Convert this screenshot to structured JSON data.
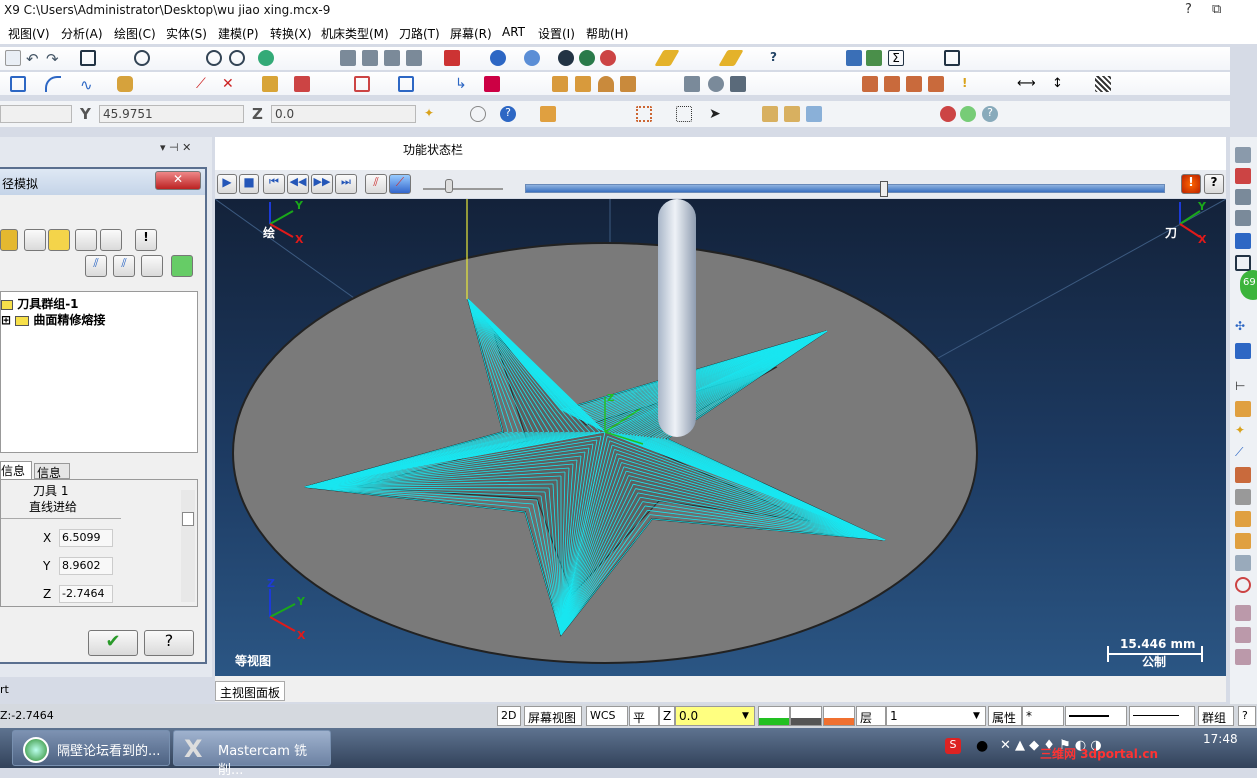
{
  "titlebar": {
    "title": "X9  C:\\Users\\Administrator\\Desktop\\wu jiao xing.mcx-9",
    "win_help": "?",
    "win_restore": "⧉"
  },
  "menu": [
    "视图(V)",
    "分析(A)",
    "绘图(C)",
    "实体(S)",
    "建模(P)",
    "转换(X)",
    "机床类型(M)",
    "刀路(T)",
    "屏幕(R)",
    "ART",
    "设置(I)",
    "帮助(H)"
  ],
  "coords": {
    "y_label": "Y",
    "y_value": "45.9751",
    "z_label": "Z",
    "z_value": "0.0"
  },
  "status_panel_label": "功能状态栏",
  "left": {
    "dialog_title": "径模拟",
    "tree_items": [
      "刀具群组-1",
      "曲面精修熔接"
    ],
    "tabs": [
      "信息",
      "信息"
    ],
    "info_tool": "刀具 1",
    "info_move": "直线进给",
    "x_label": "X",
    "x_value": "6.5099",
    "y_label": "Y",
    "y_value": "8.9602",
    "z_label": "Z",
    "z_value": "-2.7464",
    "footer": "rt"
  },
  "viewport": {
    "view_name": "等视图",
    "scale": "15.446 mm",
    "unit": "公制",
    "axis_tl": "绘",
    "axis_tr": "刀",
    "axis_x": "X",
    "axis_y": "Y",
    "axis_z": "Z",
    "badge": "69"
  },
  "bottom_tab": "主视图面板",
  "statusbar": {
    "left": "Z:-2.7464",
    "mode2d": "2D",
    "screen_view": "屏幕视图",
    "wcs": "WCS",
    "plane": "平面",
    "z": "Z",
    "z_value": "0.0",
    "level_label": "层别",
    "level_value": "1",
    "attr": "属性",
    "star": "*",
    "group": "群组"
  },
  "taskbar": {
    "task1": "隔壁论坛看到的...",
    "task2": "Mastercam 铣削...",
    "clock": "17:48",
    "watermark": "三维网 3dportal.cn"
  },
  "colors": {
    "toolpath": "#19e6f0",
    "part": "#7a7a7a",
    "viewport_top": "#13223a",
    "viewport_bottom": "#2b5684"
  }
}
